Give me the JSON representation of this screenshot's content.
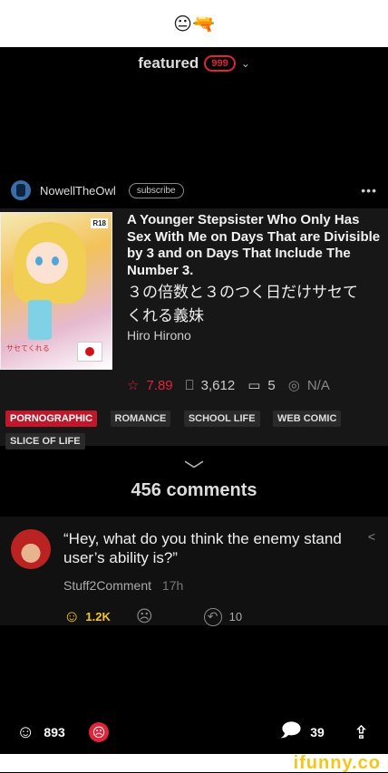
{
  "top": {
    "emojis": "😐🔫"
  },
  "feed": {
    "title": "featured",
    "badge": "999"
  },
  "user": {
    "name": "NowellTheOwl",
    "subscribe_label": "subscribe",
    "more": "•••"
  },
  "post": {
    "title": "A Younger Stepsister Who Only Has Sex With Me on Days That are Divisible by 3 and on Days That Include The Number 3.",
    "jp_title_1": "３の倍数と３のつく日だけサセて",
    "jp_title_2": "くれる義妹",
    "author": "Hiro Hirono",
    "cover_badge": "R18",
    "cover_caption": "サセてくれる",
    "rating": "7.89",
    "bookmarks": "3,612",
    "comments": "5",
    "views": "N/A",
    "tags": [
      "PORNOGRAPHIC",
      "ROMANCE",
      "SCHOOL LIFE",
      "WEB COMIC",
      "SLICE OF LIFE"
    ]
  },
  "comments_header": "456 comments",
  "comment": {
    "text": "“Hey, what do you think the enemy stand user’s ability is?”",
    "user": "Stuff2Comment",
    "time": "17h",
    "smile_count": "1.2K",
    "reply_count": "10"
  },
  "bottom": {
    "smiles": "893",
    "comments": "39"
  },
  "footer": {
    "brand": "ifunny.co"
  },
  "colors": {
    "accent_red": "#e0243a",
    "smile_yellow": "#f5c518"
  }
}
